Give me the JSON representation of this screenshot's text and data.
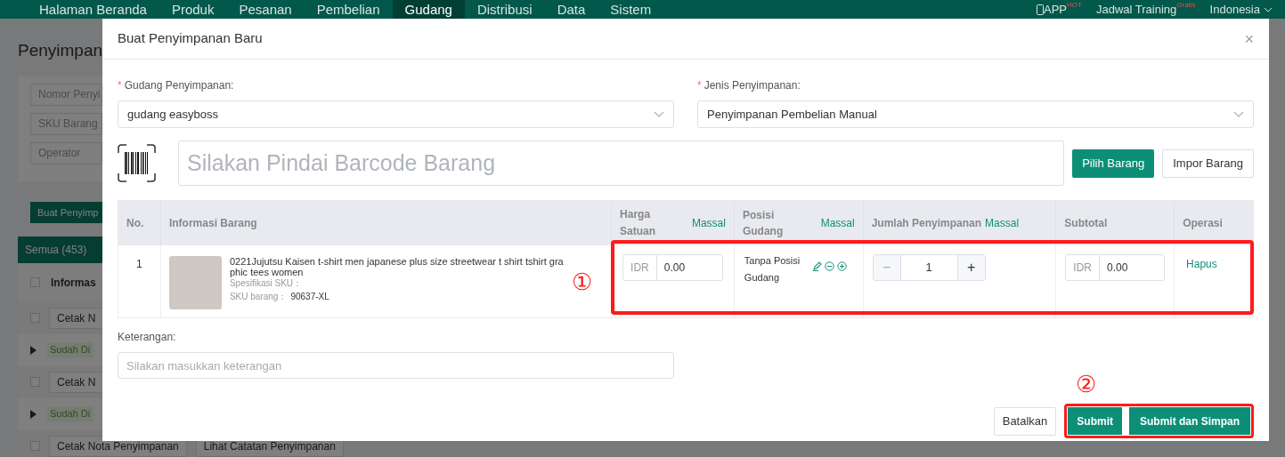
{
  "nav": {
    "items": [
      {
        "label": "Halaman Beranda",
        "selected": false
      },
      {
        "label": "Produk",
        "selected": false
      },
      {
        "label": "Pesanan",
        "selected": false
      },
      {
        "label": "Pembelian",
        "selected": false
      },
      {
        "label": "Gudang",
        "selected": true
      },
      {
        "label": "Distribusi",
        "selected": false
      },
      {
        "label": "Data",
        "selected": false
      },
      {
        "label": "Sistem",
        "selected": false
      }
    ],
    "app": {
      "label": "APP",
      "badge": "HOT"
    },
    "training": {
      "label": "Jadwal Training",
      "badge": "Gratis"
    },
    "language": "Indonesia"
  },
  "background": {
    "title": "Penyimpan",
    "filters": [
      "Nomor Penyi",
      "SKU Barang",
      "Operator"
    ],
    "create_button": "Buat Penyimp",
    "tab": "Semua (453)",
    "column": "Informas",
    "header_checked": false,
    "rows": [
      {
        "kind": "action",
        "text": "Cetak N",
        "checked": false
      },
      {
        "kind": "status",
        "text": "Sudah Di"
      },
      {
        "kind": "action",
        "text": "Cetak N",
        "checked": false
      },
      {
        "kind": "status",
        "text": "Sudah Di"
      },
      {
        "kind": "actions",
        "text": "Cetak Nota Penyimpanan",
        "extra": "Lihat Catatan Penyimpanan",
        "checked": false
      }
    ]
  },
  "modal": {
    "title": "Buat Penyimpanan Baru",
    "close": "×",
    "required_mark": "*",
    "warehouse": {
      "label": "Gudang Penyimpanan:",
      "required": true,
      "value": "gudang easyboss"
    },
    "type": {
      "label": "Jenis Penyimpanan:",
      "required": true,
      "value": "Penyimpanan Pembelian Manual"
    },
    "barcode": {
      "placeholder": "Silakan Pindai Barcode Barang"
    },
    "buttons": {
      "pick": "Pilih Barang",
      "import": "Impor Barang"
    },
    "table": {
      "columns": [
        {
          "label": "No."
        },
        {
          "label": "Informasi Barang"
        },
        {
          "label": "Harga Satuan",
          "link": "Massal"
        },
        {
          "label": "Posisi Gudang",
          "link": "Massal"
        },
        {
          "label": "Jumlah Penyimpanan",
          "link": "Massal"
        },
        {
          "label": "Subtotal"
        },
        {
          "label": "Operasi"
        }
      ],
      "rows": [
        {
          "no": "1",
          "name": "0221Jujutsu Kaisen t-shirt men japanese plus size streetwear t shirt tshirt graphic tees women",
          "spec_label": "Spesifikasi SKU：",
          "sku_label": "SKU barang：",
          "sku": "90637-XL",
          "price_currency": "IDR",
          "price": "0.00",
          "position": "Tanpa Posisi Gudang",
          "decrement": "−",
          "quantity": "1",
          "increment": "+",
          "subtotal_currency": "IDR",
          "subtotal": "0.00",
          "operation": "Hapus"
        }
      ]
    },
    "note": {
      "label": "Keterangan:",
      "placeholder": "Silakan masukkan keterangan"
    },
    "footer": {
      "cancel": "Batalkan",
      "submit": "Submit",
      "submit_save": "Submit dan Simpan"
    },
    "annotations": [
      "①",
      "②"
    ]
  }
}
